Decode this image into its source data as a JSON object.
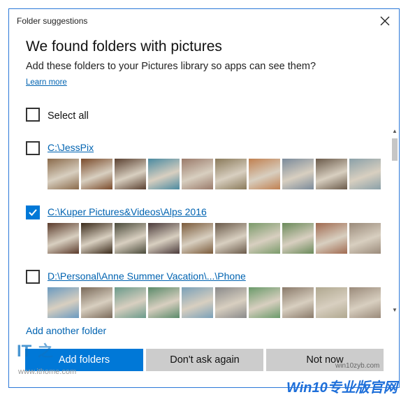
{
  "window": {
    "title": "Folder suggestions"
  },
  "heading": "We found folders with pictures",
  "description": "Add these folders to your Pictures library so apps can see them?",
  "learn_more": "Learn more",
  "select_all": {
    "label": "Select all",
    "checked": false
  },
  "folders": [
    {
      "path": "C:\\JessPix",
      "checked": false,
      "thumbs": [
        "#8a6a4a",
        "#7a4a2a",
        "#5a4030",
        "#4a8aa0",
        "#9a7a6a",
        "#8a7a5a",
        "#c08050",
        "#7a8a9a",
        "#6a5a4a",
        "#8aa0a8"
      ]
    },
    {
      "path": "C:\\Kuper Pictures&Videos\\Alps 2016",
      "checked": true,
      "thumbs": [
        "#5a3a2a",
        "#3a2a1a",
        "#4a4a3a",
        "#4a3a3a",
        "#7a5a3a",
        "#6a5a4a",
        "#7a9a6a",
        "#6a8a5a",
        "#a06a50",
        "#9a8a7a"
      ]
    },
    {
      "path": "D:\\Personal\\Anne Summer Vacation\\...\\Phone",
      "checked": false,
      "thumbs": [
        "#6a9ac0",
        "#7a6a5a",
        "#6a9a8a",
        "#5a8a6a",
        "#7aa0b8",
        "#8a8a8a",
        "#6a9a6a",
        "#8a7a6a",
        "#b0a890",
        "#9a8a7a"
      ]
    }
  ],
  "add_another": "Add another folder",
  "buttons": {
    "add": "Add folders",
    "dont_ask": "Don't ask again",
    "not_now": "Not now"
  },
  "watermarks": {
    "site": "www.ithome.com",
    "site2": "win10zyb.com",
    "brand": "Win10专业版官网"
  },
  "colors": {
    "accent": "#0078d7",
    "link": "#0063b1"
  }
}
